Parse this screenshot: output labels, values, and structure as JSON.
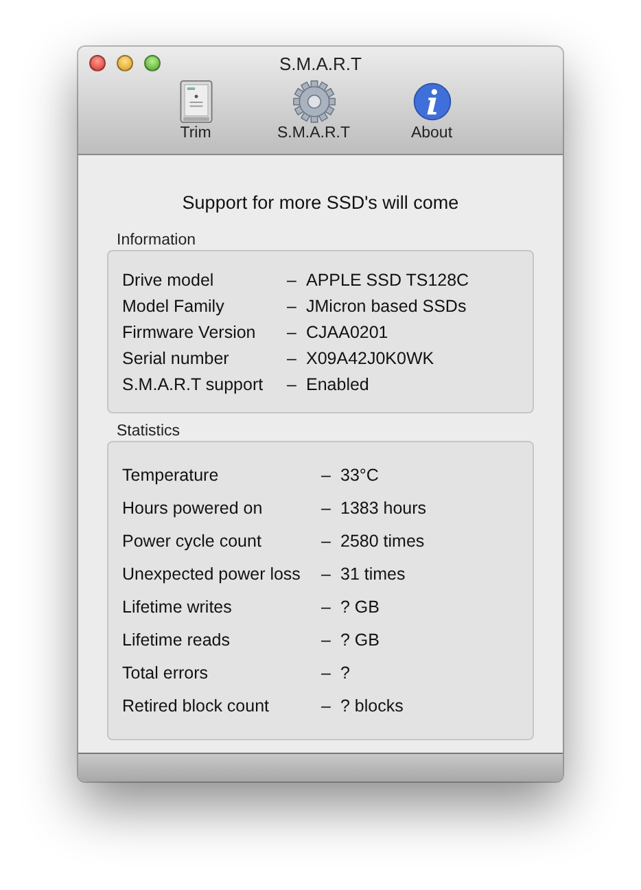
{
  "window": {
    "title": "S.M.A.R.T"
  },
  "toolbar": [
    {
      "kind": "drive",
      "label": "Trim"
    },
    {
      "kind": "gear",
      "label": "S.M.A.R.T"
    },
    {
      "kind": "info",
      "label": "About"
    }
  ],
  "headline": "Support for more SSD's will come",
  "information": {
    "title": "Information",
    "rows": [
      {
        "label": "Drive model",
        "separator": "–",
        "value": "APPLE SSD TS128C"
      },
      {
        "label": "Model Family",
        "separator": "–",
        "value": "JMicron based SSDs"
      },
      {
        "label": "Firmware Version",
        "separator": "–",
        "value": "CJAA0201"
      },
      {
        "label": "Serial number",
        "separator": "–",
        "value": "X09A42J0K0WK"
      },
      {
        "label": "S.M.A.R.T support",
        "separator": "–",
        "value": "Enabled"
      }
    ]
  },
  "statistics": {
    "title": "Statistics",
    "rows": [
      {
        "label": "Temperature",
        "separator": "–",
        "value": "33°C"
      },
      {
        "label": "Hours powered on",
        "separator": "–",
        "value": "1383 hours"
      },
      {
        "label": "Power cycle count",
        "separator": "–",
        "value": "2580 times"
      },
      {
        "label": "Unexpected power loss",
        "separator": "–",
        "value": "31 times"
      },
      {
        "label": "Lifetime writes",
        "separator": "–",
        "value": "? GB"
      },
      {
        "label": "Lifetime reads",
        "separator": "–",
        "value": "? GB"
      },
      {
        "label": "Total errors",
        "separator": "–",
        "value": "?"
      },
      {
        "label": "Retired block count",
        "separator": "–",
        "value": "? blocks"
      }
    ]
  }
}
